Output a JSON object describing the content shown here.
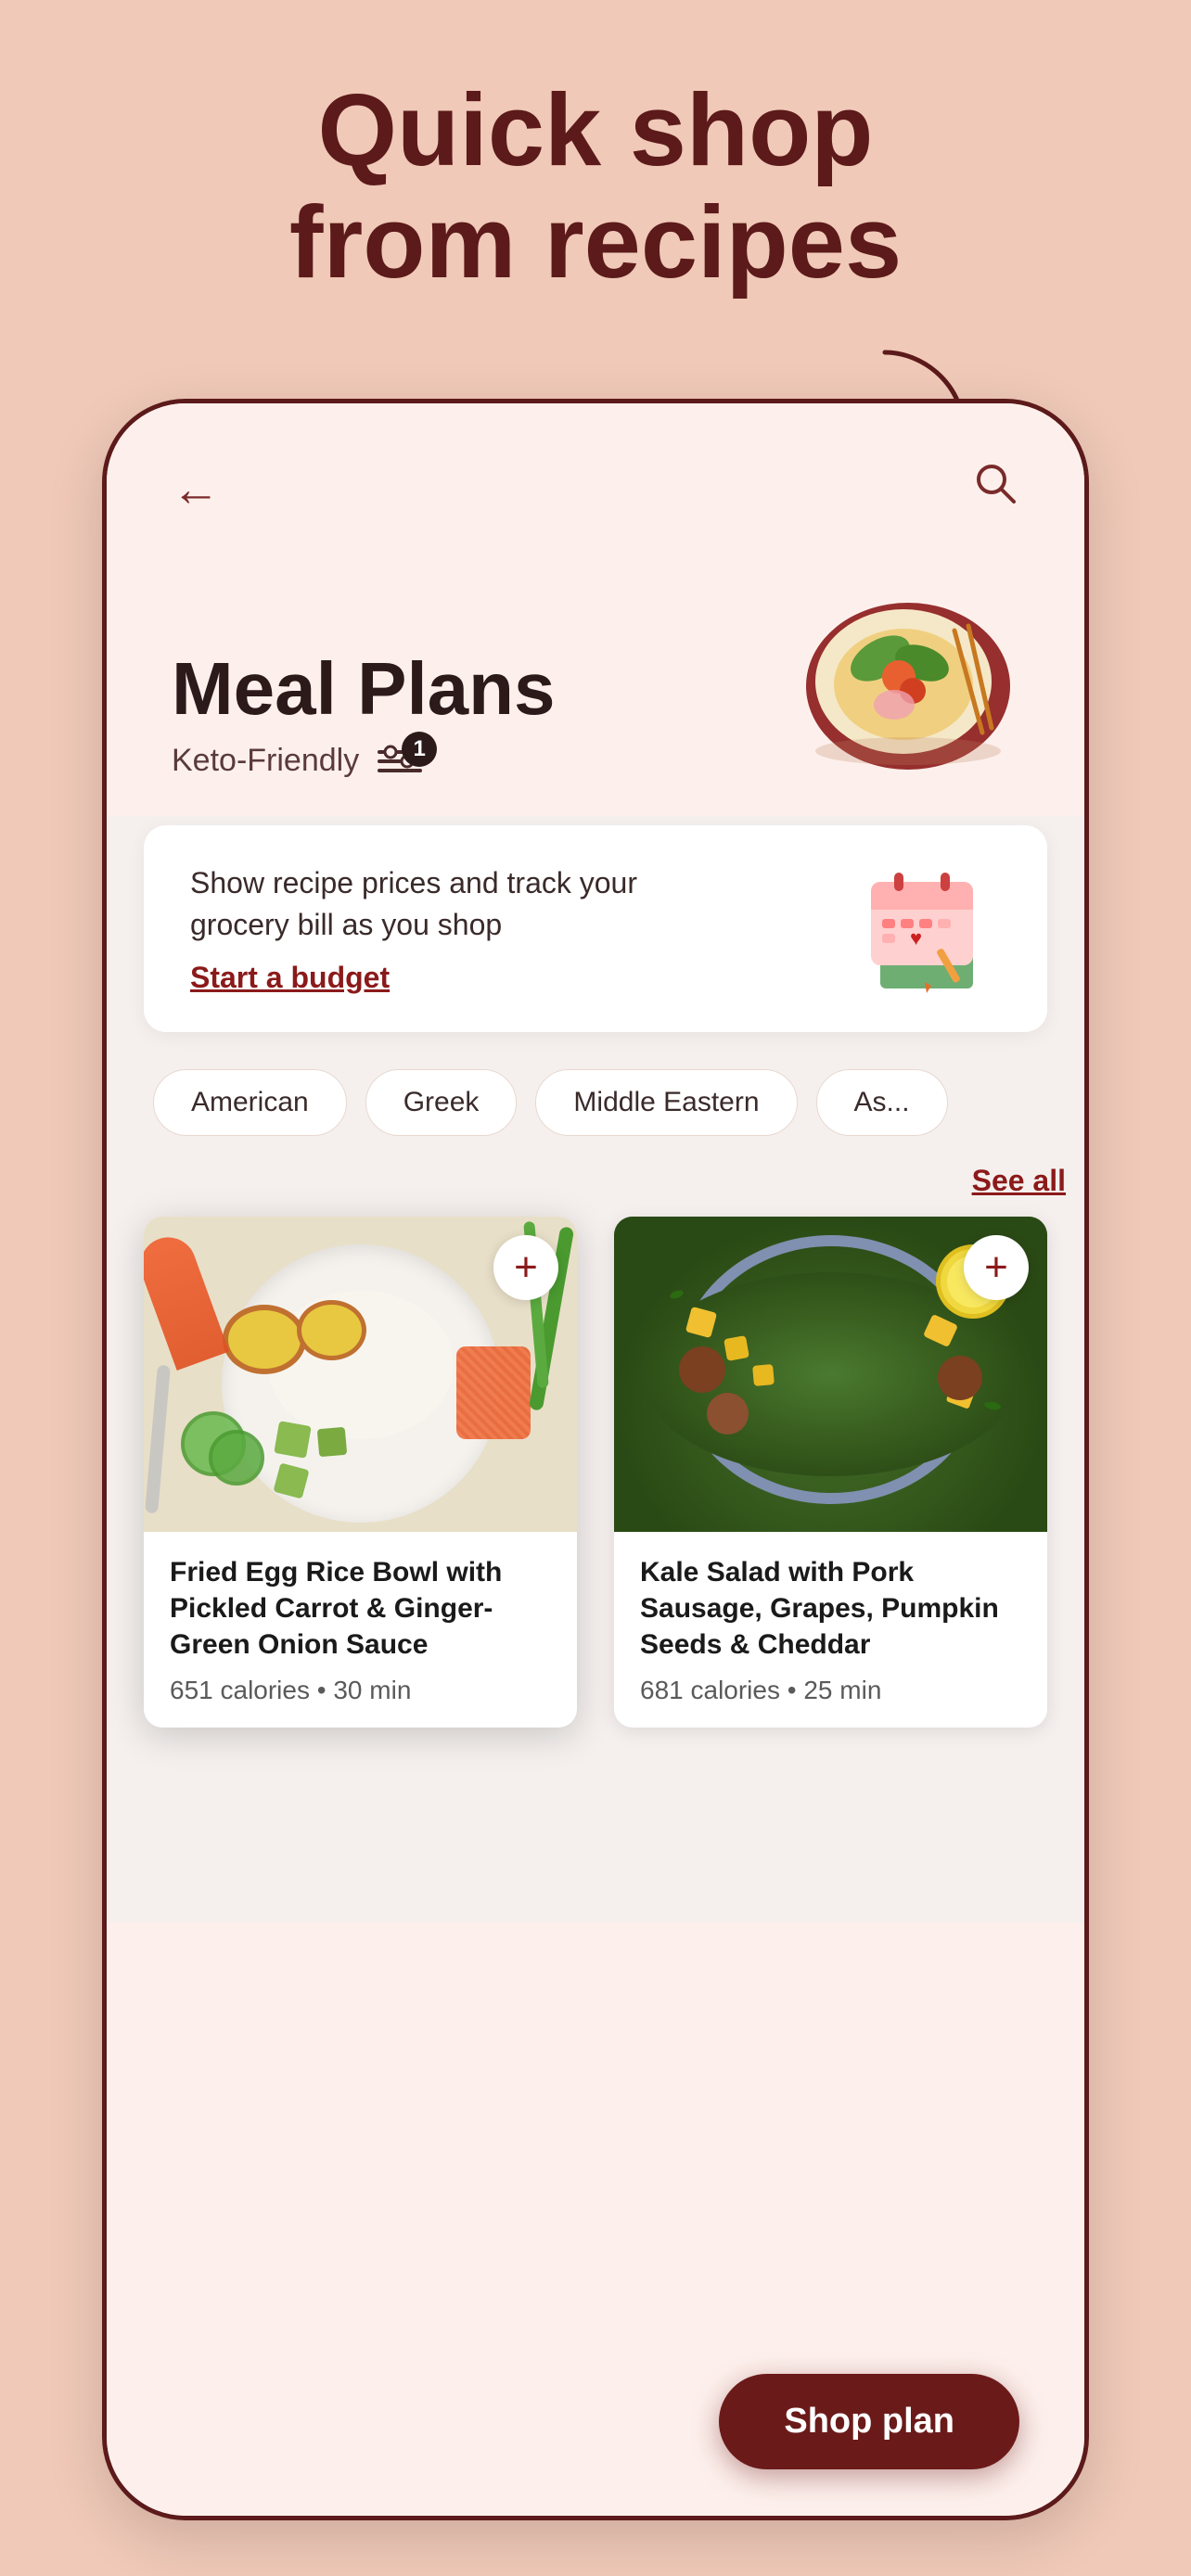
{
  "hero": {
    "title_line1": "Quick shop",
    "title_line2": "from recipes"
  },
  "header": {
    "title": "Meal Plans",
    "filter_label": "Keto-Friendly",
    "filter_badge": "1"
  },
  "budget_banner": {
    "description": "Show recipe prices and track your grocery bill as you shop",
    "cta": "Start a budget"
  },
  "categories": [
    {
      "label": "American"
    },
    {
      "label": "Greek"
    },
    {
      "label": "Middle Eastern"
    },
    {
      "label": "As..."
    }
  ],
  "see_all_label": "See all",
  "recipes": [
    {
      "name": "Fried Egg Rice Bowl with Pickled Carrot & Ginger-Green Onion Sauce",
      "calories": "651 calories",
      "time": "30 min"
    },
    {
      "name": "Kale Salad with Pork Sausage, Grapes, Pumpkin Seeds & Cheddar",
      "calories": "681 calories",
      "time": "25 min"
    }
  ],
  "shop_plan_btn": "Shop plan",
  "icons": {
    "back": "←",
    "search": "○",
    "add": "+",
    "filter": "⊟"
  }
}
